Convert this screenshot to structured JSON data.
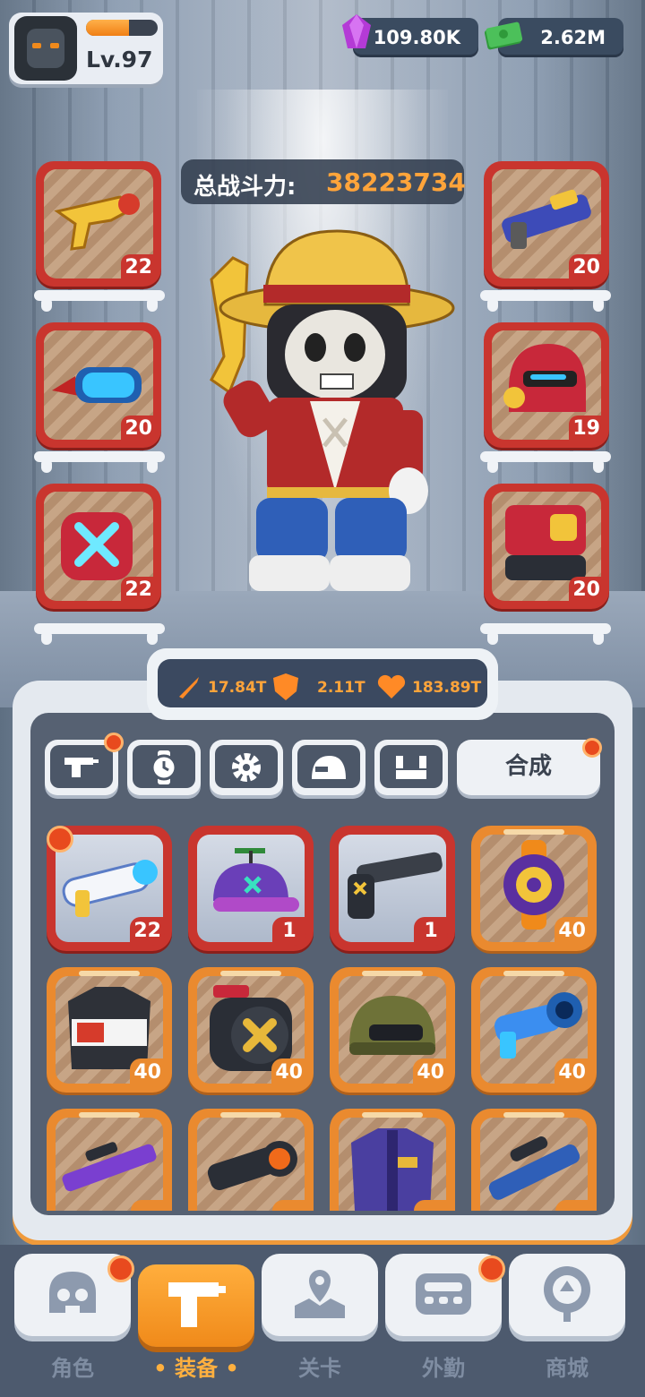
{
  "player": {
    "level": "Lv.97",
    "xp_fraction": 0.6
  },
  "currencies": {
    "gems": "109.80K",
    "cash": "2.62M"
  },
  "power": {
    "label": "总战斗力:",
    "value": "38223734"
  },
  "equipped_left": [
    {
      "name": "golden-revolver",
      "level": "22"
    },
    {
      "name": "goggles",
      "level": "20"
    },
    {
      "name": "armor-vest",
      "level": "22"
    }
  ],
  "equipped_right": [
    {
      "name": "blaster-rifle",
      "level": "20"
    },
    {
      "name": "red-helmet",
      "level": "19"
    },
    {
      "name": "red-boots",
      "level": "20"
    }
  ],
  "stats": {
    "attack": "17.84T",
    "defense": "2.11T",
    "health": "183.89T"
  },
  "tabs": {
    "icons": [
      "gun-icon",
      "watch-icon",
      "gear-icon",
      "helmet-icon",
      "armor-icon"
    ],
    "merge_label": "合成"
  },
  "inventory": [
    {
      "name": "laser-pistol",
      "level": "22",
      "rarity": "red"
    },
    {
      "name": "propeller-cap",
      "level": "1",
      "rarity": "red"
    },
    {
      "name": "shotgun",
      "level": "1",
      "rarity": "red"
    },
    {
      "name": "purple-watch",
      "level": "40",
      "rarity": "orange"
    },
    {
      "name": "racing-jacket",
      "level": "40",
      "rarity": "orange"
    },
    {
      "name": "ammo-drum-armor",
      "level": "40",
      "rarity": "orange"
    },
    {
      "name": "military-helmet",
      "level": "40",
      "rarity": "orange"
    },
    {
      "name": "blue-blaster",
      "level": "40",
      "rarity": "orange"
    },
    {
      "name": "sniper-rifle",
      "level": "",
      "rarity": "orange"
    },
    {
      "name": "scope",
      "level": "",
      "rarity": "orange"
    },
    {
      "name": "purple-jacket",
      "level": "",
      "rarity": "orange"
    },
    {
      "name": "scoped-rifle",
      "level": "",
      "rarity": "orange"
    }
  ],
  "nav": [
    {
      "label": "角色",
      "icon": "skull-icon"
    },
    {
      "label": "• 装备 •",
      "icon": "gun-icon",
      "selected": true
    },
    {
      "label": "关卡",
      "icon": "map-icon"
    },
    {
      "label": "外勤",
      "icon": "controller-icon"
    },
    {
      "label": "商城",
      "icon": "shop-icon"
    }
  ],
  "colors": {
    "accent": "#f08a1a",
    "rarity_red": "#c9352e",
    "rarity_orange": "#ea8a2f",
    "power_value": "#ffa43a"
  }
}
